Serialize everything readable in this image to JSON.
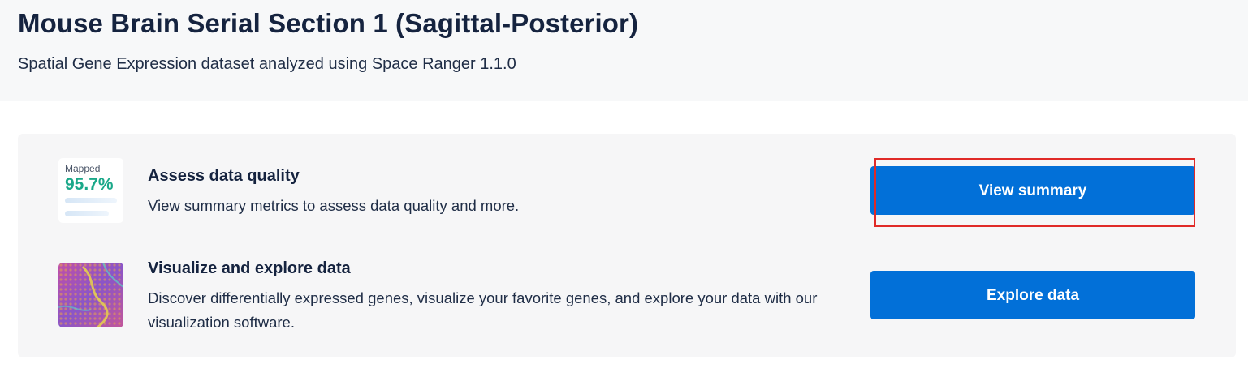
{
  "header": {
    "title": "Mouse Brain Serial Section 1 (Sagittal-Posterior)",
    "subtitle": "Spatial Gene Expression dataset analyzed using Space Ranger 1.1.0"
  },
  "card": {
    "rows": [
      {
        "thumbnail": {
          "label": "Mapped",
          "value": "95.7%"
        },
        "title": "Assess data quality",
        "description": "View summary metrics to assess data quality and more.",
        "button_label": "View summary"
      },
      {
        "thumbnail": {
          "icon": "tissue-image-icon"
        },
        "title": "Visualize and explore data",
        "description": "Discover differentially expressed genes, visualize your favorite genes, and explore your data with our visualization software.",
        "button_label": "Explore data"
      }
    ]
  },
  "colors": {
    "button": "#0270d8",
    "mapped_value": "#1aa889",
    "highlight": "#e02a27",
    "header_bg": "#f7f8f9",
    "card_bg": "#f6f6f7"
  }
}
